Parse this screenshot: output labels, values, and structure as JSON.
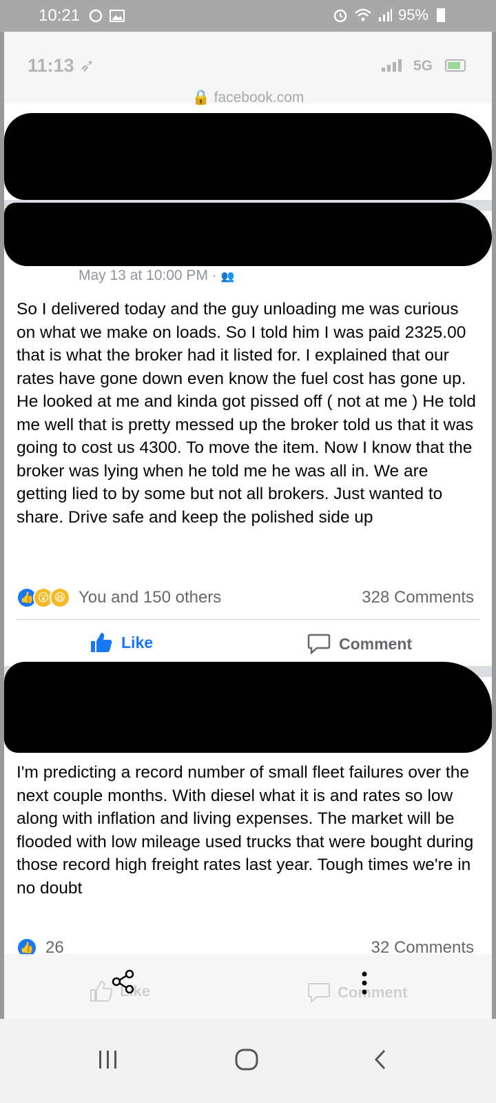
{
  "android_status": {
    "time": "10:21",
    "battery": "95%"
  },
  "ios_status": {
    "time": "11:13",
    "network": "5G",
    "url": "facebook.com"
  },
  "post1": {
    "meta": "May 13 at 10:00 PM ·",
    "text": "So I delivered today and the guy unloading me was curious on what we make on loads. So I told him I was paid 2325.00 that is what the broker had it listed for. I explained that our rates have gone down even know the fuel cost has gone up. He looked at me and kinda got pissed off ( not at me ) He told me well that is pretty messed up the broker told us that it was going to cost us 4300. To move the item. Now I know that the broker was lying when he told me he was all in. We are getting lied to by some but not all brokers. Just wanted to share. Drive safe and keep the polished side up",
    "reactions_text": "You and 150 others",
    "comments": "328 Comments",
    "like_label": "Like",
    "comment_label": "Comment"
  },
  "post2": {
    "text": "I'm predicting a record number of small fleet failures over the next couple months. With diesel what it is and rates so low along with inflation and living expenses. The market will be flooded with low mileage used trucks that were bought during those record high freight rates last year. Tough times we're in no doubt",
    "reactions_count": "26",
    "comments": "32 Comments",
    "like_label": "Like",
    "comment_label": "Comment"
  },
  "colors": {
    "facebook_blue": "#1877f2",
    "secondary_text": "#65676b",
    "separator": "#dadde1"
  },
  "icons": [
    "alarm-icon",
    "wifi-icon",
    "signal-icon",
    "image-icon",
    "lock-icon",
    "like-icon",
    "wow-icon",
    "haha-icon",
    "comment-icon",
    "share-icon",
    "more-icon",
    "recent-apps-icon",
    "home-icon",
    "back-icon"
  ]
}
